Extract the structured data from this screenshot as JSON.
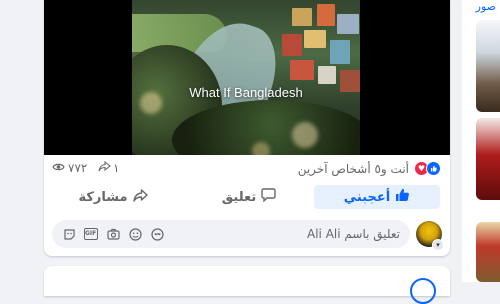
{
  "post": {
    "video": {
      "caption": "What If Bangladesh"
    },
    "stats": {
      "views": "٧٧٢",
      "shares": "١",
      "reactions_text": "أنت و٥ أشخاص آخرين",
      "reaction_types": [
        "like",
        "love"
      ],
      "like_color": "#0866ff",
      "love_color": "#f02849"
    },
    "actions": {
      "like_label": "أعجبني",
      "comment_label": "تعليق",
      "share_label": "مشاركة"
    },
    "comment_composer": {
      "placeholder": "تعليق باسم Ali Ali",
      "tools": [
        "avatar-sticker-icon",
        "gif-icon",
        "camera-icon",
        "emoji-icon",
        "sticker-icon"
      ]
    }
  },
  "sidebar_right": {
    "title": "صور"
  },
  "colors": {
    "accent": "#0866ff",
    "background": "#f0f2f5",
    "secondary_text": "#65676b"
  }
}
